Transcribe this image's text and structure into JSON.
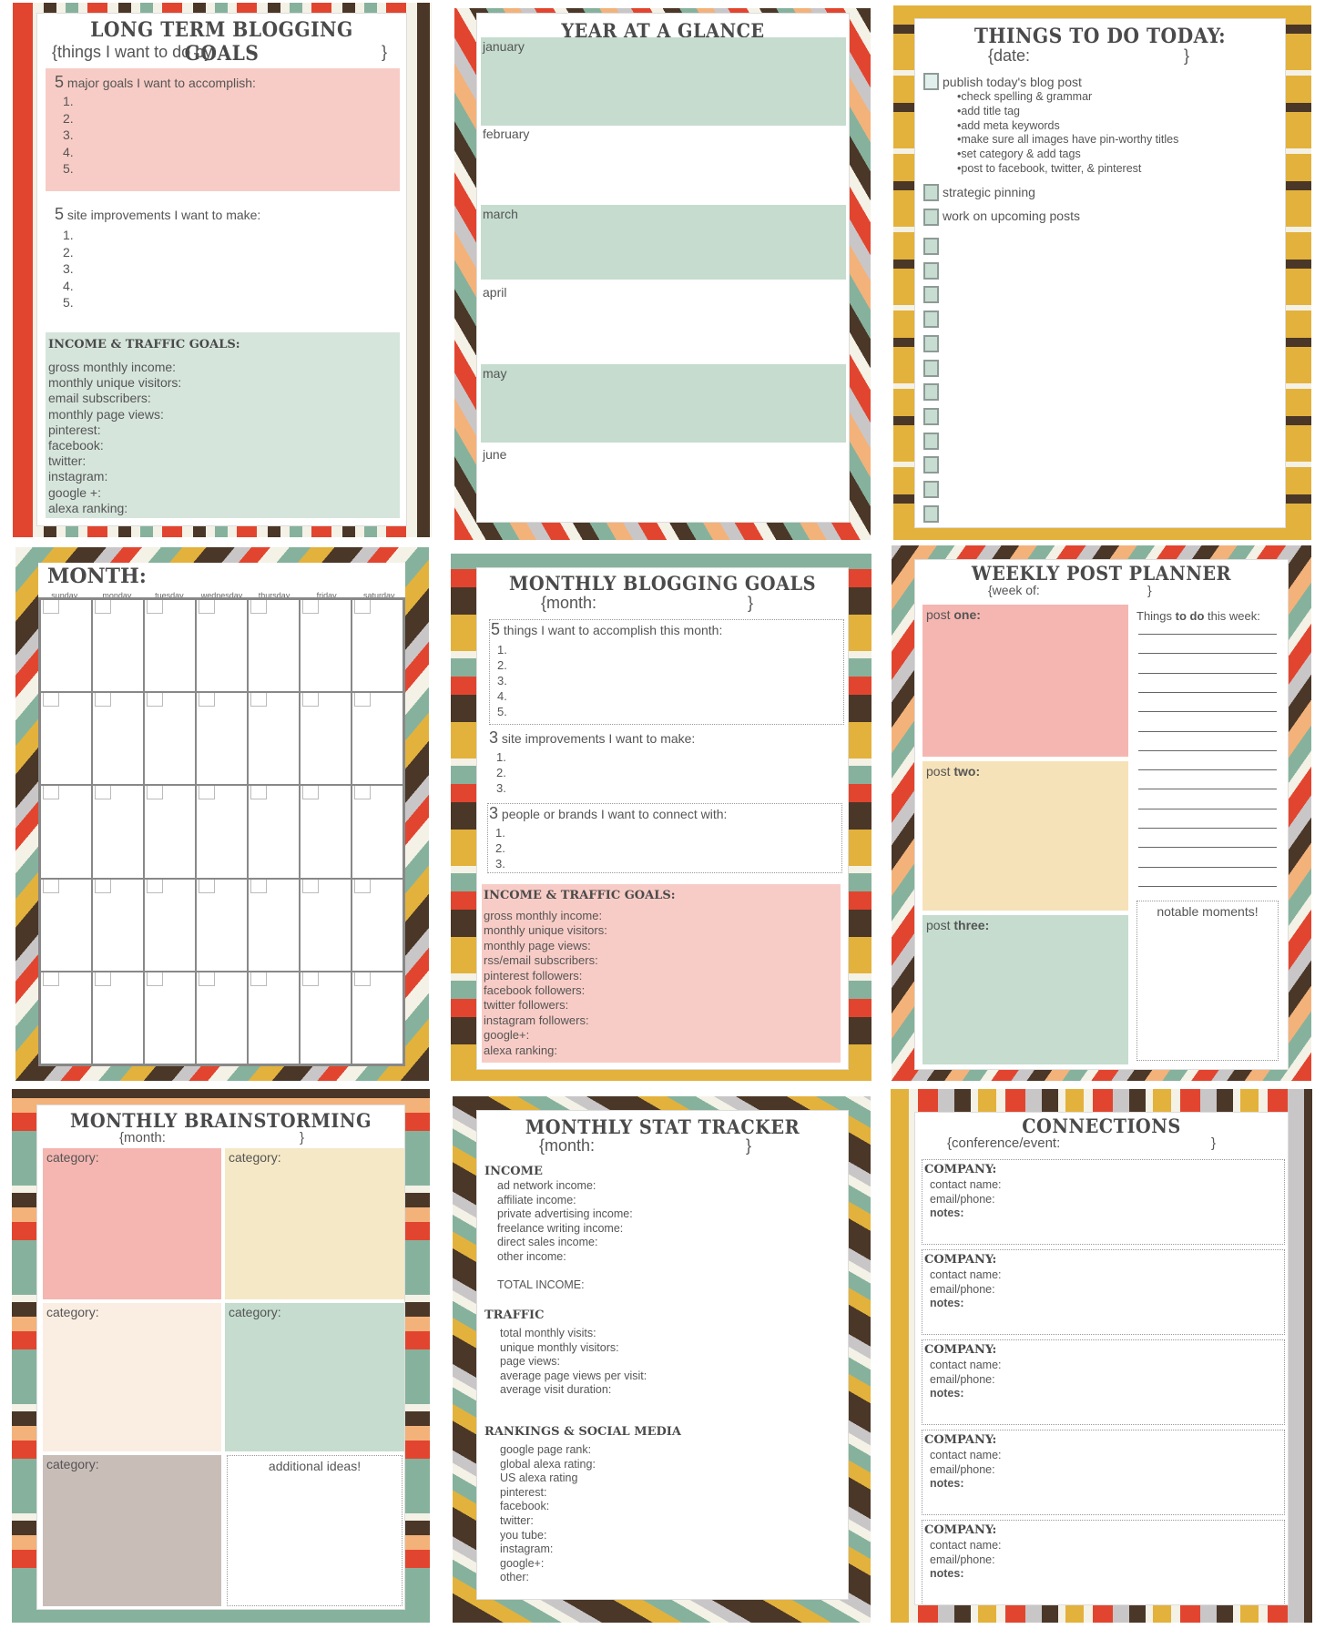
{
  "colors": {
    "red": "#e2452f",
    "brown": "#4a3728",
    "teal": "#86b29d",
    "cream": "#f4f1e6",
    "orange": "#f3b27a",
    "gray": "#c9c6c8",
    "mustard": "#e3b23c",
    "pink_box": "#f8ccc6",
    "mint_box": "#c5dccf",
    "yellow_box": "#f5e2b8"
  },
  "long_term": {
    "title": "LONG TERM BLOGGING GOALS",
    "subtitle": "{things I want to do by:",
    "subtitle_close": "}",
    "major_num": "5",
    "major_heading": "major goals I want to accomplish:",
    "major_items": [
      "1.",
      "2.",
      "3.",
      "4.",
      "5."
    ],
    "site_num": "5",
    "site_heading": "site improvements I want to make:",
    "site_items": [
      "1.",
      "2.",
      "3.",
      "4.",
      "5."
    ],
    "income_heading": "INCOME & TRAFFIC GOALS:",
    "income_items": [
      "gross monthly income:",
      "monthly unique visitors:",
      "email subscribers:",
      "monthly page views:",
      "pinterest:",
      "facebook:",
      "twitter:",
      "instagram:",
      "google +:",
      "alexa ranking:"
    ]
  },
  "year": {
    "title": "YEAR AT A GLANCE",
    "months": [
      "january",
      "february",
      "march",
      "april",
      "may",
      "june"
    ]
  },
  "today": {
    "title": "THINGS TO DO TODAY:",
    "date": "{date:",
    "date_close": "}",
    "task1": "publish today's blog post",
    "subtasks": [
      "•check spelling & grammar",
      "•add title tag",
      "•add meta keywords",
      "•make sure all images have pin-worthy titles",
      "•set category & add tags",
      "•post to facebook, twitter, & pinterest"
    ],
    "task2": "strategic pinning",
    "task3": "work on upcoming posts"
  },
  "calendar": {
    "title": "MONTH:",
    "weekdays": [
      "sunday",
      "monday",
      "tuesday",
      "wednesday",
      "thursday",
      "friday",
      "saturday"
    ]
  },
  "monthly_goals": {
    "title": "MONTHLY BLOGGING GOALS",
    "month": "{month:",
    "month_close": "}",
    "things_num": "5",
    "things_heading": "things I want to accomplish this month:",
    "things_items": [
      "1.",
      "2.",
      "3.",
      "4.",
      "5."
    ],
    "site_num": "3",
    "site_heading": "site improvements I want to make:",
    "site_items": [
      "1.",
      "2.",
      "3."
    ],
    "people_num": "3",
    "people_heading": "people or brands I want to connect with:",
    "people_items": [
      "1.",
      "2.",
      "3."
    ],
    "income_heading": "INCOME & TRAFFIC GOALS:",
    "income_items": [
      "gross monthly income:",
      "monthly unique visitors:",
      "monthly page views:",
      "rss/email subscribers:",
      "pinterest followers:",
      "facebook followers:",
      "twitter followers:",
      "instagram followers:",
      "google+:",
      "alexa ranking:"
    ]
  },
  "weekly": {
    "title": "WEEKLY POST PLANNER",
    "week": "{week of:",
    "week_close": "}",
    "post_label": "post",
    "posts": [
      "one:",
      "two:",
      "three:"
    ],
    "todo_pre": "Things ",
    "todo_bold": "to do",
    "todo_post": " this week:",
    "notable": "notable moments!"
  },
  "brainstorm": {
    "title": "MONTHLY BRAINSTORMING",
    "month": "{month:",
    "month_close": "}",
    "category": "category:",
    "additional": "additional ideas!"
  },
  "stats": {
    "title": "MONTHLY STAT TRACKER",
    "month": "{month:",
    "month_close": "}",
    "income_heading": "INCOME",
    "income_items": [
      "ad network income:",
      "affiliate income:",
      "private advertising income:",
      "freelance writing income:",
      "direct sales income:",
      "other income:"
    ],
    "total": "TOTAL INCOME:",
    "traffic_heading": "TRAFFIC",
    "traffic_items": [
      "total monthly visits:",
      "unique monthly visitors:",
      "page views:",
      "average page views per visit:",
      "average visit duration:"
    ],
    "rank_heading": "RANKINGS & SOCIAL MEDIA",
    "rank_items": [
      "google page rank:",
      "global alexa rating:",
      "US alexa rating",
      "pinterest:",
      "facebook:",
      "twitter:",
      "you tube:",
      "instagram:",
      "google+:",
      "other:"
    ]
  },
  "connections": {
    "title": "CONNECTIONS",
    "event": "{conference/event:",
    "event_close": "}",
    "company": "COMPANY:",
    "contact": "contact name:",
    "email": "email/phone:",
    "notes": "notes:"
  }
}
